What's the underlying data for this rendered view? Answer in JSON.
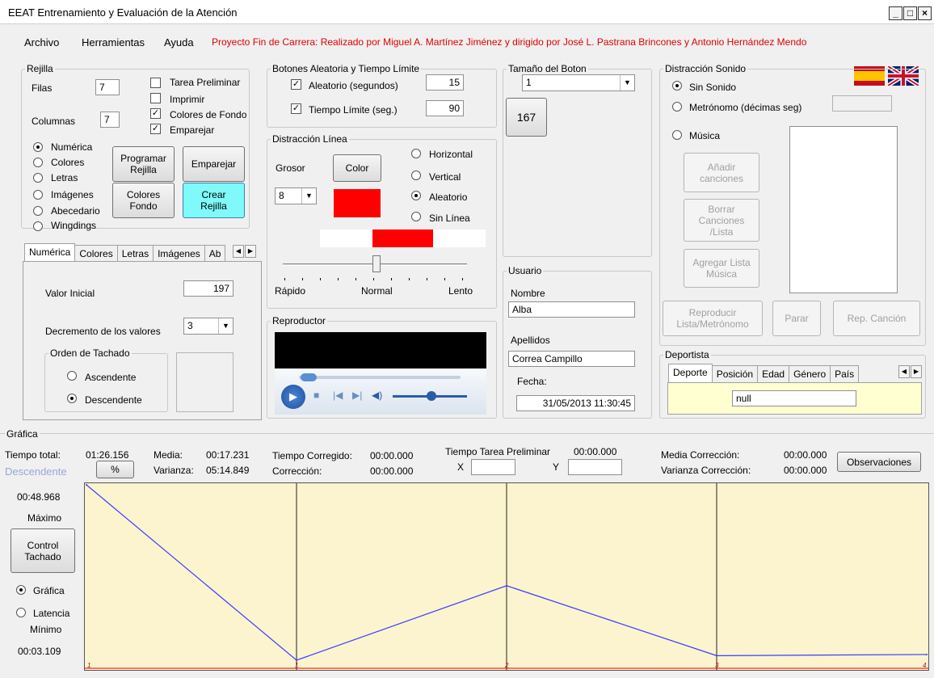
{
  "window": {
    "title": "EEAT Entrenamiento y Evaluación de la Atención",
    "minimize": "_",
    "maximize": "□",
    "close": "×"
  },
  "menu": {
    "archivo": "Archivo",
    "herramientas": "Herramientas",
    "ayuda": "Ayuda",
    "note": "Proyecto Fin de Carrera: Realizado por Miguel A. Martínez Jiménez y dirigido por José L. Pastrana Brincones y Antonio Hernández Mendo"
  },
  "rejilla": {
    "legend": "Rejilla",
    "filas_label": "Filas",
    "filas": "7",
    "columnas_label": "Columnas",
    "columnas": "7",
    "check_tarea": "Tarea Preliminar",
    "check_imprimir": "Imprimir",
    "check_colores": "Colores de Fondo",
    "check_emparejar": "Emparejar",
    "radio_numerica": "Numérica",
    "radio_colores": "Colores",
    "radio_letras": "Letras",
    "radio_imagenes": "Imágenes",
    "radio_abecedario": "Abecedario",
    "radio_wingdings": "Wingdings",
    "btn_programar": "Programar Rejilla",
    "btn_emparejar": "Emparejar",
    "btn_colores_fondo": "Colores Fondo",
    "btn_crear": "Crear Rejilla"
  },
  "tabs_rejilla": {
    "numerica": "Numérica",
    "colores": "Colores",
    "letras": "Letras",
    "imagenes": "Imágenes",
    "ab": "Ab"
  },
  "numerica": {
    "valor_inicial_label": "Valor Inicial",
    "valor_inicial": "197",
    "decremento_label": "Decremento de los valores",
    "decremento": "3",
    "orden_legend": "Orden de Tachado",
    "ascendente": "Ascendente",
    "descendente": "Descendente"
  },
  "botones": {
    "legend": "Botones Aleatoria y Tiempo Límite",
    "aleatorio_label": "Aleatorio (segundos)",
    "aleatorio": "15",
    "tiempo_label": "Tiempo Límite (seg.)",
    "tiempo": "90"
  },
  "linea": {
    "legend": "Distracción Línea",
    "grosor_label": "Grosor",
    "grosor": "8",
    "color_btn": "Color",
    "horizontal": "Horizontal",
    "vertical": "Vertical",
    "aleatorio": "Aleatorio",
    "sin_linea": "Sin Línea",
    "rapido": "Rápido",
    "normal": "Normal",
    "lento": "Lento",
    "color": "#ff0000"
  },
  "reproductor": {
    "legend": "Reproductor"
  },
  "tamano": {
    "legend": "Tamaño del Boton",
    "value": "1",
    "preview": "167"
  },
  "usuario": {
    "legend": "Usuario",
    "nombre_label": "Nombre",
    "nombre": "Alba",
    "apellidos_label": "Apellidos",
    "apellidos": "Correa Campillo",
    "fecha_label": "Fecha:",
    "fecha": "31/05/2013 11:30:45"
  },
  "sonido": {
    "legend": "Distracción Sonido",
    "sin_sonido": "Sin Sonido",
    "metronomo": "Metrónomo (décimas seg)",
    "musica": "Música",
    "btn_anadir": "Añadir canciones",
    "btn_borrar": "Borrar Canciones /Lista",
    "btn_agregar": "Agregar Lista Música",
    "btn_reproducir": "Reproducir Lista/Metrónomo",
    "btn_parar": "Parar",
    "btn_rep": "Rep. Canción"
  },
  "deportista": {
    "legend": "Deportista",
    "tab_deporte": "Deporte",
    "tab_posicion": "Posición",
    "tab_edad": "Edad",
    "tab_genero": "Género",
    "tab_pais": "País",
    "value": "null"
  },
  "grafica": {
    "legend": "Gráfica",
    "tiempo_total_label": "Tiempo total:",
    "tiempo_total": "01:26.156",
    "media_label": "Media:",
    "media": "00:17.231",
    "varianza_label": "Varianza:",
    "varianza": "05:14.849",
    "descendente": "Descendente",
    "pct_btn": "%",
    "tiempo_corregido_label": "Tiempo Corregido:",
    "tiempo_corregido": "00:00.000",
    "correccion_label": "Corrección:",
    "correccion": "00:00.000",
    "tarea_label": "Tiempo Tarea Preliminar",
    "tarea": "00:00.000",
    "x_label": "X",
    "y_label": "Y",
    "media_corr_label": "Media Corrección:",
    "media_corr": "00:00.000",
    "var_corr_label": "Varianza Corrección:",
    "var_corr": "00:00.000",
    "observaciones": "Observaciones",
    "max_value": "00:48.968",
    "max_label": "Máximo",
    "control_btn": "Control Tachado",
    "radio_grafica": "Gráfica",
    "radio_latencia": "Latencia",
    "min_label": "Mínimo",
    "min_value": "00:03.109",
    "x_ticks": [
      "1",
      "1",
      "2",
      "3",
      "4"
    ]
  },
  "chart_data": {
    "type": "line",
    "x": [
      0,
      1,
      2,
      3,
      4
    ],
    "values": [
      48.968,
      3.109,
      22.6,
      4.3,
      4.6
    ],
    "ylim": [
      3.109,
      48.968
    ]
  }
}
